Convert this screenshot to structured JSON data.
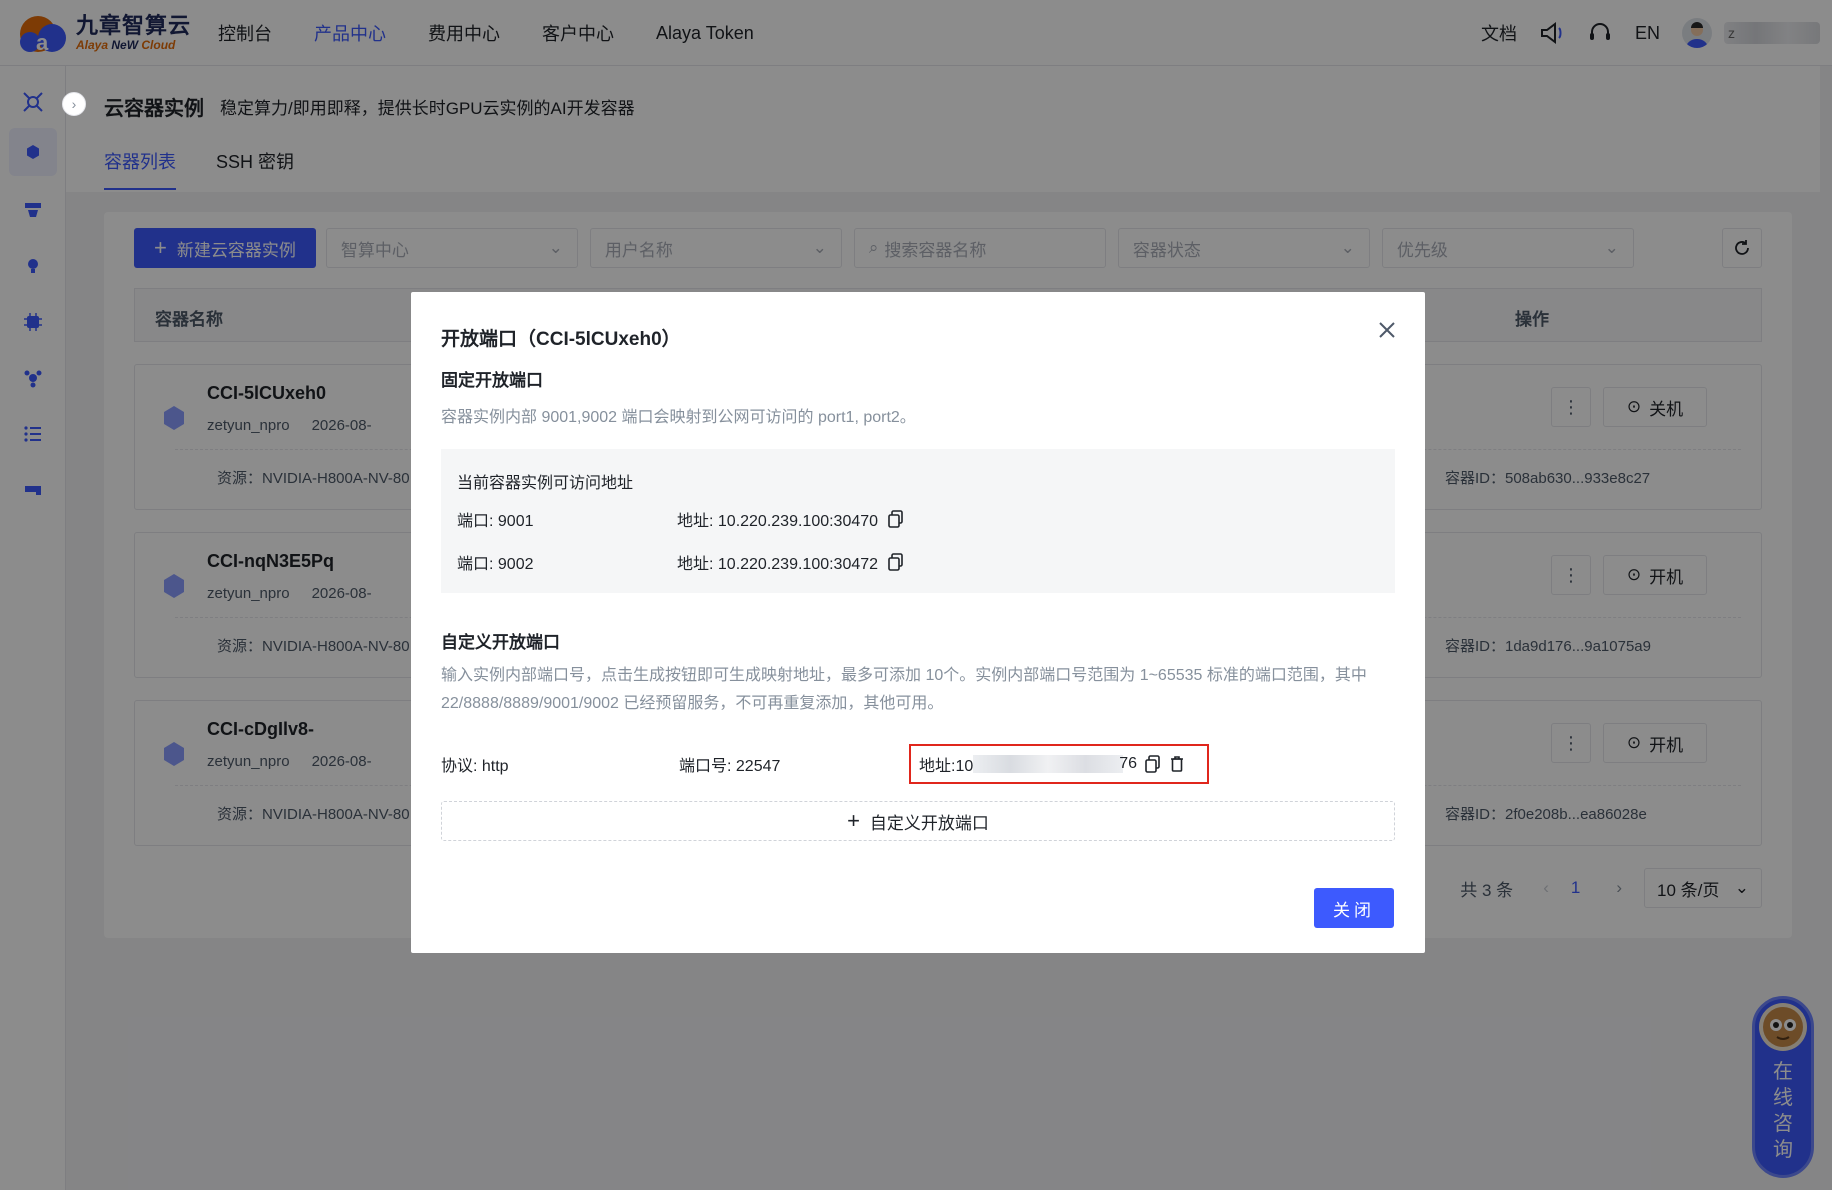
{
  "brand": {
    "cn": "九章智算云",
    "en_a": "Alaya ",
    "en_b": "NeW",
    "en_c": " Cloud"
  },
  "nav": [
    "控制台",
    "产品中心",
    "费用中心",
    "客户中心",
    "Alaya Token"
  ],
  "top_right": {
    "docs": "文档",
    "lang": "EN",
    "user_initial": "z"
  },
  "page": {
    "title": "云容器实例",
    "subtitle": "稳定算力/即用即释，提供长时GPU云实例的AI开发容器",
    "tabs": [
      "容器列表",
      "SSH 密钥"
    ]
  },
  "toolbar": {
    "new_button": "新建云容器实例",
    "filters": [
      "智算中心",
      "用户名称"
    ],
    "search_placeholder": "搜索容器名称",
    "filters2": [
      "容器状态",
      "优先级"
    ]
  },
  "table": {
    "col_name": "容器名称",
    "col_action": "操作",
    "rows": [
      {
        "name": "CCI-5lCUxeh0",
        "user": "zetyun_npro",
        "date": "2026-08-",
        "resource": "资源：NVIDIA-H800A-NV-80",
        "id": "容器ID：508ab630...933e8c27",
        "action": "关机"
      },
      {
        "name": "CCI-nqN3E5Pq",
        "user": "zetyun_npro",
        "date": "2026-08-",
        "resource": "资源：NVIDIA-H800A-NV-80",
        "id": "容器ID：1da9d176...9a1075a9",
        "action": "开机"
      },
      {
        "name": "CCI-cDgIlv8-",
        "user": "zetyun_npro",
        "date": "2026-08-",
        "resource": "资源：NVIDIA-H800A-NV-80",
        "id": "容器ID：2f0e208b...ea86028e",
        "action": "开机"
      }
    ]
  },
  "pager": {
    "total": "共 3 条",
    "current": "1",
    "size": "10 条/页"
  },
  "modal": {
    "title": "开放端口（CCI-5lCUxeh0）",
    "fixed_title": "固定开放端口",
    "fixed_hint": "容器实例内部 9001,9002 端口会映射到公网可访问的 port1, port2。",
    "box_title": "当前容器实例可访问地址",
    "ports": [
      {
        "port": "端口: 9001",
        "addr": "地址: 10.220.239.100:30470"
      },
      {
        "port": "端口: 9002",
        "addr": "地址: 10.220.239.100:30472"
      }
    ],
    "custom_title": "自定义开放端口",
    "custom_hint": "输入实例内部端口号，点击生成按钮即可生成映射地址，最多可添加 10个。实例内部端口号范围为 1~65535 标准的端口范围，其中 22/8888/8889/9001/9002 已经预留服务，不可再重复添加，其他可用。",
    "custom": {
      "proto": "协议: http",
      "port": "端口号: 22547",
      "addr_prefix": "地址:10",
      "addr_suffix": "76"
    },
    "add_custom": "自定义开放端口",
    "close": "关闭"
  },
  "chat": "在线咨询",
  "colors": {
    "primary": "#3d5afe",
    "highlight": "#e0261c"
  }
}
